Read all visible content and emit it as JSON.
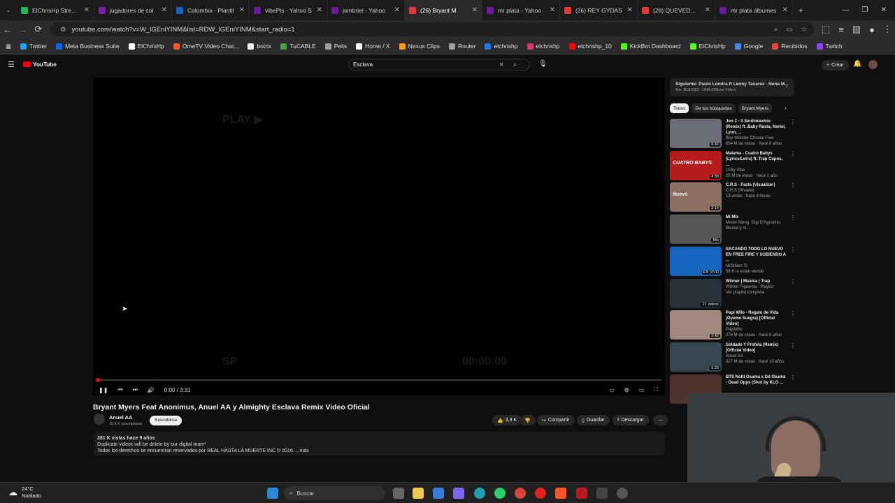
{
  "browser": {
    "tabs": [
      {
        "title": "ElChrisHp Stream",
        "color": "#1db954",
        "active": false
      },
      {
        "title": "jugadores de col",
        "color": "#7b1fa2",
        "active": false
      },
      {
        "title": "Colombia - Plantil",
        "color": "#1565c0",
        "active": false
      },
      {
        "title": "vibePls - Yahoo S",
        "color": "#6a1b9a",
        "active": false
      },
      {
        "title": "jombriel - Yahoo",
        "color": "#6a1b9a",
        "active": false
      },
      {
        "title": "(26) Bryant M",
        "color": "#e53935",
        "active": true
      },
      {
        "title": "mr plata - Yahoo",
        "color": "#6a1b9a",
        "active": false
      },
      {
        "title": "(26) REY GYDAS",
        "color": "#e53935",
        "active": false
      },
      {
        "title": "(26) QUEVEDO B",
        "color": "#e53935",
        "active": false
      },
      {
        "title": "mr plata álbumes",
        "color": "#6a1b9a",
        "active": false
      }
    ],
    "url": "youtube.com/watch?v=W_lGEniYINM&list=RDW_lGEniYINM&start_radio=1",
    "bookmarks": [
      {
        "label": "Twitter",
        "color": "#1da1f2"
      },
      {
        "label": "Meta Business Suite",
        "color": "#0866ff"
      },
      {
        "label": "ElChrisHp",
        "color": "#ffffff"
      },
      {
        "label": "OmeTV Video Chat...",
        "color": "#ff5722"
      },
      {
        "label": "botrix",
        "color": "#eeeeee"
      },
      {
        "label": "TuCABLE",
        "color": "#43a047"
      },
      {
        "label": "Pelis",
        "color": "#9e9e9e"
      },
      {
        "label": "Home / X",
        "color": "#ffffff"
      },
      {
        "label": "Nexus Clips",
        "color": "#ff9800"
      },
      {
        "label": "Router",
        "color": "#9e9e9e"
      },
      {
        "label": "elchrishp",
        "color": "#1877f2"
      },
      {
        "label": "elchrishp",
        "color": "#e1306c"
      },
      {
        "label": "elchrishp_10",
        "color": "#ff0000"
      },
      {
        "label": "KickBot Dashboard",
        "color": "#53fc18"
      },
      {
        "label": "ElChrisHp",
        "color": "#53fc18"
      },
      {
        "label": "Google",
        "color": "#4285f4"
      },
      {
        "label": "Recibidos",
        "color": "#ea4335"
      },
      {
        "label": "Twitch",
        "color": "#9146ff"
      }
    ]
  },
  "youtube": {
    "logo": "YouTube",
    "search_value": "Esclava",
    "create_label": "Crear",
    "player": {
      "time": "0:00 / 3:31",
      "ghost_play": "PLAY ▶",
      "ghost_sp": "SP",
      "ghost_timecode": "00:00:00"
    },
    "video": {
      "title": "Bryant Myers Feat Anonimus, Anuel AA y Almighty Esclava Remix Video Oficial",
      "channel": "Anuel AA",
      "subscribers": "10,5 K suscriptores",
      "subscribe_label": "Suscribirse",
      "likes": "3,3 K",
      "share_label": "Compartir",
      "save_label": "Guardar",
      "download_label": "Descargar",
      "desc_meta": "281 K vistas  hace 9 años",
      "desc_line1": "Duplicate videos will be delete by our digital team*",
      "desc_line2": "Todos los derechos se encuentran reservados por REAL HASTA LA MUERTE INC © 2016. ...más"
    },
    "next_up": {
      "title": "Siguiente: Paulo Londra ft Lenny Tavarez - Nena M...",
      "sub": "Mix: BLESSD - UNA (Official Video)"
    },
    "chips": [
      "Todos",
      "De tus búsquedas",
      "Bryant Myers"
    ],
    "recommendations": [
      {
        "title": "Jon Z - 0 Sentimientos (Remix) ft. Baby Rasta, Noriel, Lyon, ...",
        "channel": "Boy Wonder Chosen Few",
        "meta": "654 M de vistas · hace 8 años",
        "duration": "6:42",
        "color": "#6b6f75",
        "badge": ""
      },
      {
        "title": "Maluma - Cuatro Babys (Lyrics/Letra) ft. Trap Capos, ...",
        "channel": "Unity Vibe",
        "meta": "25 M de vistas · hace 1 año",
        "duration": "4:39",
        "color": "#b71c1c",
        "badge": "CUATRO BABYS"
      },
      {
        "title": "C.R.S - Facts (Visualizer)",
        "channel": "C.R.S (Rivada)",
        "meta": "13 vistas · hace 8 horas",
        "duration": "2:19",
        "color": "#8d6e63",
        "badge": "Nuevo"
      },
      {
        "title": "Mi Mix",
        "channel": "Mister Meng, Gigi D'Agostino, Blessd y m...",
        "meta": "",
        "duration": "Mix",
        "color": "#555555",
        "badge": ""
      },
      {
        "title": "SACANDO TODO LO NUEVO EN FREE FIRE Y SUBIENDO A ...",
        "channel": "MrStiven Tc",
        "meta": "56 K lo están viendo",
        "duration": "EN VIVO",
        "color": "#1565c0",
        "badge": ""
      },
      {
        "title": "Wilmer | Musica | Trap",
        "channel": "Wilmer Figueroa · Playlist",
        "meta": "Ver playlist completa",
        "duration": "21 videos",
        "color": "#263238",
        "badge": ""
      },
      {
        "title": "Papi Wilo - Regalo de Vida (Oyeme Suegra) [Official Video]",
        "channel": "PapiWilo",
        "meta": "276 M de vistas · hace 9 años",
        "duration": "3:42",
        "color": "#a1887f",
        "badge": ""
      },
      {
        "title": "Soldado Y Profeta (Remix) [Official Video]",
        "channel": "Anuel AA",
        "meta": "327 M de vistas · hace 10 años",
        "duration": "6:29",
        "color": "#37474f",
        "badge": ""
      },
      {
        "title": "BTS Notti Osama x Dd Osama - Dead Opps (Shot by KLO ...",
        "channel": "",
        "meta": "",
        "duration": "",
        "color": "#4e342e",
        "badge": ""
      }
    ]
  },
  "taskbar": {
    "temp": "24°C",
    "weather": "Nublado",
    "search_placeholder": "Buscar"
  }
}
